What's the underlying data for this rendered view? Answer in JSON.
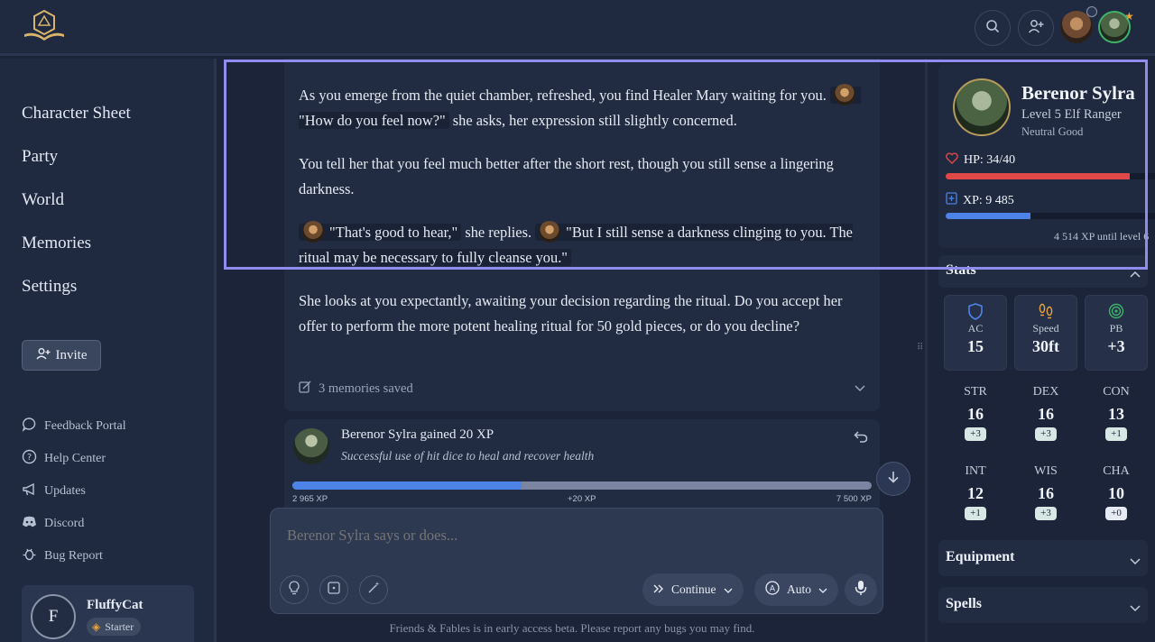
{
  "topbar": {
    "logo_icon": "d20-book-logo",
    "search_icon": "search-icon",
    "add_user_icon": "add-user-icon"
  },
  "sidebar": {
    "nav": [
      {
        "label": "Character Sheet"
      },
      {
        "label": "Party"
      },
      {
        "label": "World"
      },
      {
        "label": "Memories"
      },
      {
        "label": "Settings"
      }
    ],
    "invite_label": "Invite",
    "links": [
      {
        "label": "Feedback Portal",
        "icon": "chat-bubble-icon"
      },
      {
        "label": "Help Center",
        "icon": "help-circle-icon"
      },
      {
        "label": "Updates",
        "icon": "megaphone-icon"
      },
      {
        "label": "Discord",
        "icon": "discord-icon"
      },
      {
        "label": "Bug Report",
        "icon": "bug-icon"
      }
    ],
    "user": {
      "initial": "F",
      "name": "FluffyCat",
      "tier": "Starter"
    }
  },
  "story": {
    "p1_a": "As you emerge from the quiet chamber, refreshed, you find Healer Mary waiting for you.",
    "p1_quote": "\"How do you feel now?\"",
    "p1_b": "she asks, her expression still slightly concerned.",
    "p2": "You tell her that you feel much better after the short rest, though you still sense a lingering darkness.",
    "p3_quote1": "\"That's good to hear,\"",
    "p3_mid": "she replies.",
    "p3_quote2": "\"But I still sense a darkness clinging to you. The ritual may be necessary to fully cleanse you.\"",
    "p4": "She looks at you expectantly, awaiting your decision regarding the ritual. Do you accept her offer to perform the more potent healing ritual for 50 gold pieces, or do you decline?",
    "memories": "3 memories saved"
  },
  "xp_event": {
    "title": "Berenor Sylra gained 20 XP",
    "subtitle": "Successful use of hit dice to heal and recover health",
    "start": "2 965 XP",
    "gain": "+20 XP",
    "end": "7 500 XP",
    "progress": 0.395
  },
  "composer": {
    "placeholder": "Berenor Sylra says or does...",
    "continue_label": "Continue",
    "auto_label": "Auto"
  },
  "footer": "Friends & Fables is in early access beta. Please report any bugs you may find.",
  "character": {
    "name": "Berenor Sylra",
    "class_line": "Level 5 Elf Ranger",
    "alignment": "Neutral Good",
    "hp_label": "HP: 34/40",
    "hp_fraction": 0.85,
    "xp_label": "XP: 9 485",
    "xp_fraction": 0.39,
    "xp_until": "4 514 XP until level 6",
    "hp_color": "#e04848",
    "xp_color": "#4d82e6"
  },
  "stats": {
    "title": "Stats",
    "combat": [
      {
        "label": "AC",
        "value": "15",
        "icon": "shield-icon"
      },
      {
        "label": "Speed",
        "value": "30ft",
        "icon": "footprints-icon"
      },
      {
        "label": "PB",
        "value": "+3",
        "icon": "target-icon"
      }
    ],
    "abilities": [
      {
        "label": "STR",
        "value": "16",
        "mod": "+3"
      },
      {
        "label": "DEX",
        "value": "16",
        "mod": "+3"
      },
      {
        "label": "CON",
        "value": "13",
        "mod": "+1"
      },
      {
        "label": "INT",
        "value": "12",
        "mod": "+1"
      },
      {
        "label": "WIS",
        "value": "16",
        "mod": "+3"
      },
      {
        "label": "CHA",
        "value": "10",
        "mod": "+0"
      }
    ]
  },
  "equipment_title": "Equipment",
  "spells_title": "Spells"
}
